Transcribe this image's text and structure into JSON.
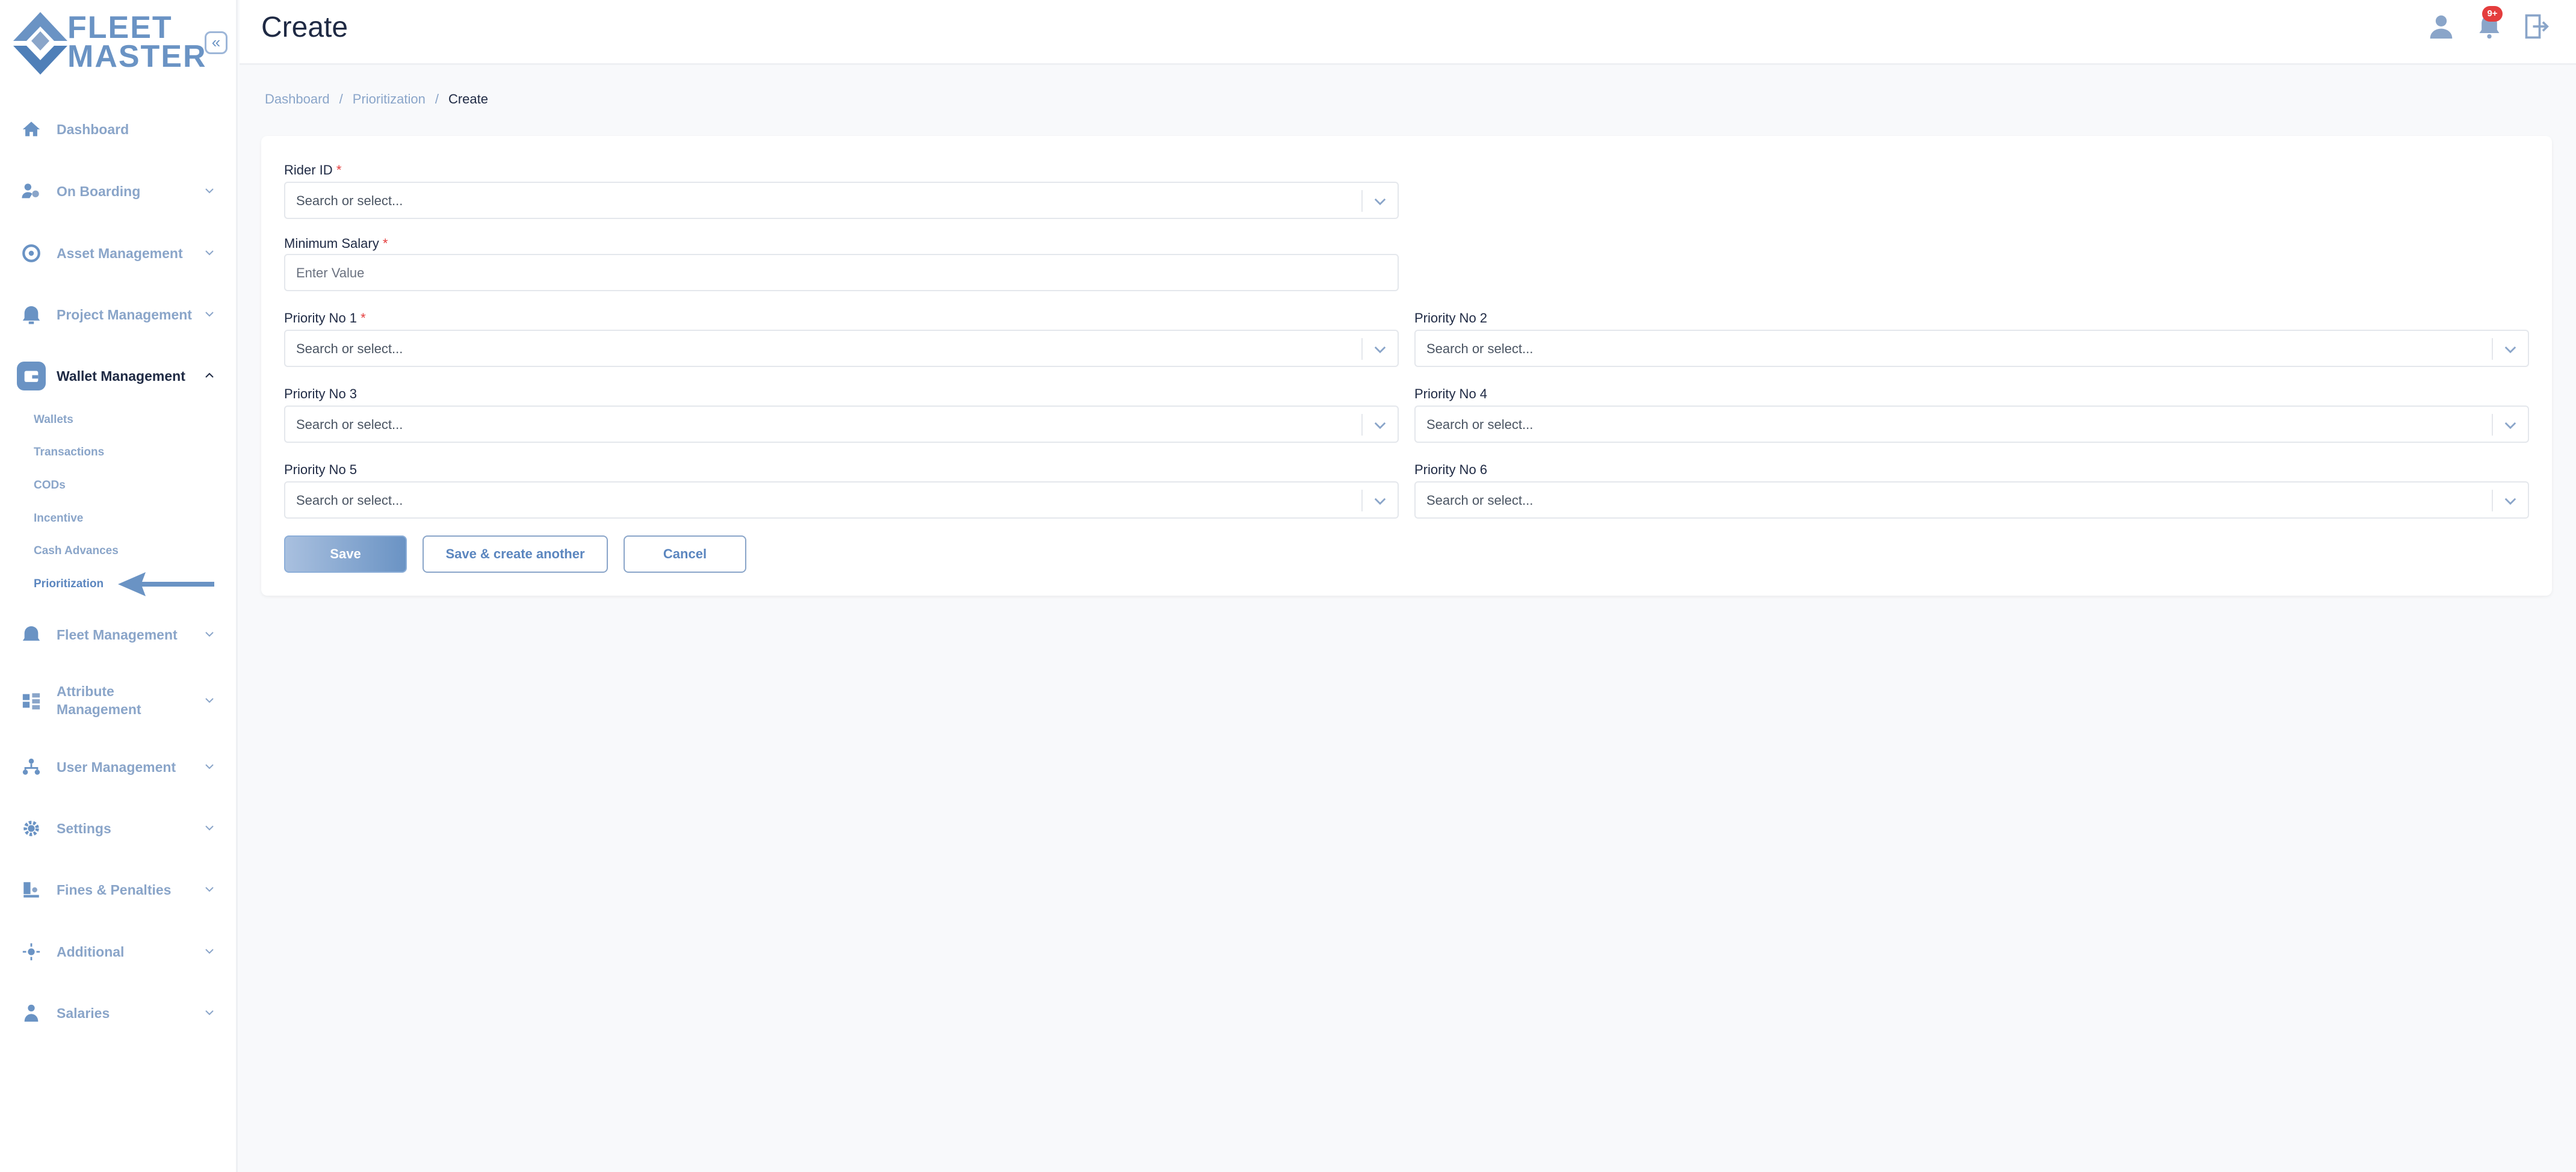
{
  "app": {
    "logo_line1": "FLEET",
    "logo_line2": "MASTER",
    "collapse_symbol": "«"
  },
  "header": {
    "title": "Create",
    "notification_badge": "9+"
  },
  "breadcrumb": {
    "items": [
      "Dashboard",
      "Prioritization",
      "Create"
    ],
    "separator": "/"
  },
  "sidebar": {
    "items": [
      {
        "label": "Dashboard",
        "icon": "home-icon"
      },
      {
        "label": "On Boarding",
        "icon": "onboarding-icon"
      },
      {
        "label": "Asset Management",
        "icon": "asset-icon"
      },
      {
        "label": "Project Management",
        "icon": "project-icon"
      },
      {
        "label": "Wallet Management",
        "icon": "wallet-icon",
        "active": true
      },
      {
        "label": "Fleet Management",
        "icon": "fleet-icon"
      },
      {
        "label": "Attribute",
        "label2": "Management",
        "icon": "attribute-icon"
      },
      {
        "label": "User Management",
        "icon": "users-icon"
      },
      {
        "label": "Settings",
        "icon": "gear-icon"
      },
      {
        "label": "Fines & Penalties",
        "icon": "fines-icon"
      },
      {
        "label": "Additional",
        "icon": "additional-icon"
      },
      {
        "label": "Salaries",
        "icon": "salaries-icon"
      }
    ],
    "wallet_sub": [
      "Wallets",
      "Transactions",
      "CODs",
      "Incentive",
      "Cash Advances",
      "Prioritization"
    ]
  },
  "form": {
    "rider_id": {
      "label": "Rider ID",
      "required": "*",
      "placeholder": "Search or select..."
    },
    "min_salary": {
      "label": "Minimum Salary",
      "required": "*",
      "placeholder": "Enter Value"
    },
    "p1": {
      "label": "Priority No 1",
      "required": "*",
      "placeholder": "Search or select..."
    },
    "p2": {
      "label": "Priority No 2",
      "placeholder": "Search or select..."
    },
    "p3": {
      "label": "Priority No 3",
      "placeholder": "Search or select..."
    },
    "p4": {
      "label": "Priority No 4",
      "placeholder": "Search or select..."
    },
    "p5": {
      "label": "Priority No 5",
      "placeholder": "Search or select..."
    },
    "p6": {
      "label": "Priority No 6",
      "placeholder": "Search or select..."
    }
  },
  "buttons": {
    "save": "Save",
    "save_another": "Save & create another",
    "cancel": "Cancel"
  },
  "colors": {
    "accent": "#6a93c4",
    "required": "#e43d3d",
    "badge": "#e43d3d"
  }
}
